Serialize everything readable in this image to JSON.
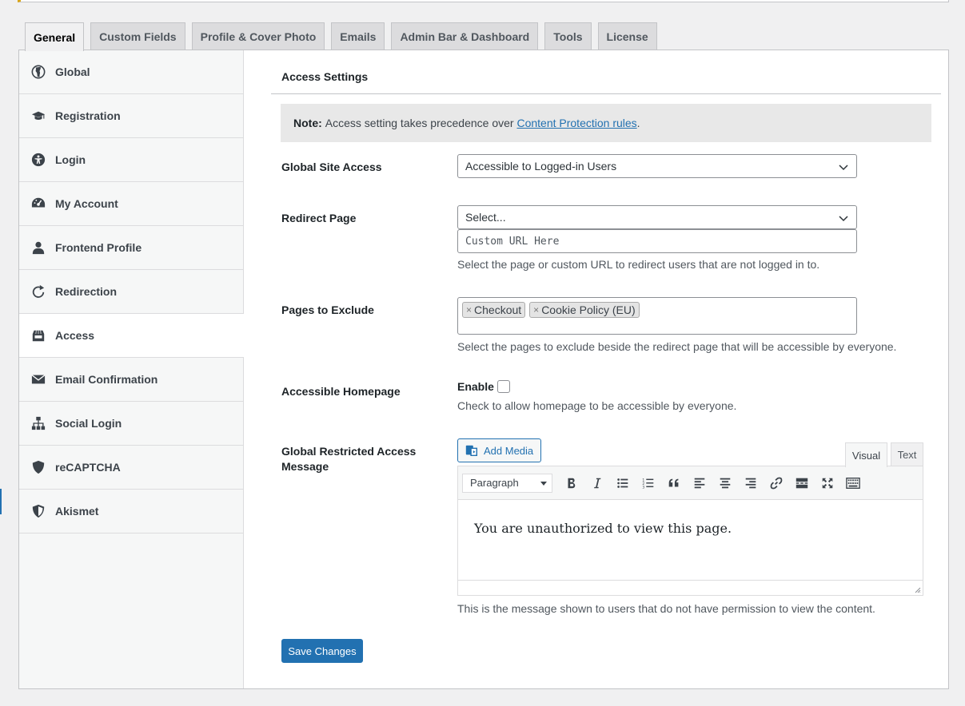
{
  "tabs": [
    {
      "label": "General",
      "active": true
    },
    {
      "label": "Custom Fields"
    },
    {
      "label": "Profile & Cover Photo"
    },
    {
      "label": "Emails"
    },
    {
      "label": "Admin Bar & Dashboard"
    },
    {
      "label": "Tools"
    },
    {
      "label": "License"
    }
  ],
  "sidebar": {
    "items": [
      {
        "label": "Global",
        "icon": "globe-icon"
      },
      {
        "label": "Registration",
        "icon": "graduation-cap-icon"
      },
      {
        "label": "Login",
        "icon": "universal-access-icon"
      },
      {
        "label": "My Account",
        "icon": "dashboard-gauge-icon"
      },
      {
        "label": "Frontend Profile",
        "icon": "user-icon"
      },
      {
        "label": "Redirection",
        "icon": "redo-arrow-icon"
      },
      {
        "label": "Access",
        "icon": "store-icon",
        "active": true
      },
      {
        "label": "Email Confirmation",
        "icon": "envelope-icon"
      },
      {
        "label": "Social Login",
        "icon": "sitemap-icon"
      },
      {
        "label": "reCAPTCHA",
        "icon": "shield-icon"
      },
      {
        "label": "Akismet",
        "icon": "half-shield-icon"
      }
    ]
  },
  "content": {
    "section_title": "Access Settings",
    "note": {
      "bold": "Note:",
      "text": "Access setting takes precedence over",
      "link": "Content Protection rules",
      "end": "."
    },
    "global_site_access": {
      "label": "Global Site Access",
      "value": "Accessible to Logged-in Users"
    },
    "redirect_page": {
      "label": "Redirect Page",
      "value": "Select...",
      "custom_url_placeholder": "Custom URL Here",
      "description": "Select the page or custom URL to redirect users that are not logged in to."
    },
    "pages_to_exclude": {
      "label": "Pages to Exclude",
      "chips": [
        "Checkout",
        "Cookie Policy (EU)"
      ],
      "chip_remove": "×",
      "description": "Select the pages to exclude beside the redirect page that will be accessible by everyone."
    },
    "accessible_homepage": {
      "label": "Accessible Homepage",
      "enable_label": "Enable",
      "checked": false,
      "description": "Check to allow homepage to be accessible by everyone."
    },
    "restricted_message": {
      "label_line1": "Global Restricted Access",
      "label_line2": "Message",
      "add_media": "Add Media",
      "tab_visual": "Visual",
      "tab_text": "Text",
      "format_select": "Paragraph",
      "body": "You are unauthorized to view this page.",
      "description": "This is the message shown to users that do not have permission to view the content."
    },
    "save_button": "Save Changes"
  },
  "colors": {
    "primary": "#2271b1",
    "notice_accent": "#dba617"
  }
}
